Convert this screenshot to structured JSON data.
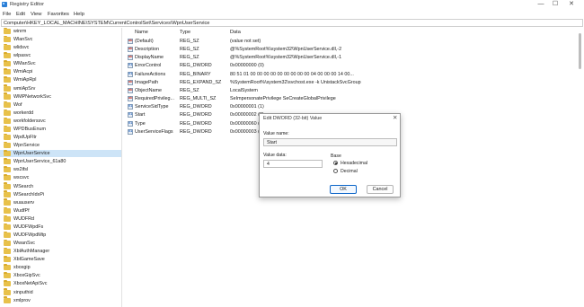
{
  "window": {
    "title": "Registry Editor",
    "min_glyph": "—",
    "max_glyph": "☐",
    "close_glyph": "✕"
  },
  "menu": [
    "File",
    "Edit",
    "View",
    "Favorites",
    "Help"
  ],
  "address": "Computer\\HKEY_LOCAL_MACHINE\\SYSTEM\\CurrentControlSet\\Services\\WpnUserService",
  "tree": {
    "items": [
      "winrm",
      "WlanSvc",
      "wlidsvc",
      "wlpasvc",
      "WManSvc",
      "WmiAcpi",
      "WmiApRpl",
      "wmiApSrv",
      "WMPNetworkSvc",
      "Wof",
      "workerdd",
      "workfolderssvc",
      "WPDBusEnum",
      "WpdUpFltr",
      "WpnService",
      "WpnUserService",
      "WpnUserService_61a80",
      "ws2ifsl",
      "wscsvc",
      "WSearch",
      "WSearchIdxPi",
      "wuauserv",
      "WudfPf",
      "WUDFRd",
      "WUDFWpdFs",
      "WUDFWpdMtp",
      "WwanSvc",
      "XblAuthManager",
      "XblGameSave",
      "xboxgip",
      "XboxGipSvc",
      "XboxNetApiSvc",
      "xinputhid",
      "xmlprov"
    ],
    "selected": "WpnUserService"
  },
  "columns": {
    "name": "Name",
    "type": "Type",
    "data": "Data"
  },
  "values": [
    {
      "icon": "string-value-icon",
      "name": "(Default)",
      "type": "REG_SZ",
      "data": "(value not set)"
    },
    {
      "icon": "string-value-icon",
      "name": "Description",
      "type": "REG_SZ",
      "data": "@%SystemRoot%\\system32\\WpnUserService.dll,-2"
    },
    {
      "icon": "string-value-icon",
      "name": "DisplayName",
      "type": "REG_SZ",
      "data": "@%SystemRoot%\\system32\\WpnUserService.dll,-1"
    },
    {
      "icon": "dword-value-icon",
      "name": "ErrorControl",
      "type": "REG_DWORD",
      "data": "0x00000000 (0)"
    },
    {
      "icon": "dword-value-icon",
      "name": "FailureActions",
      "type": "REG_BINARY",
      "data": "80 51 01 00 00 00 00 00 00 00 00 00 04 00 00 00 14 00..."
    },
    {
      "icon": "string-value-icon",
      "name": "ImagePath",
      "type": "REG_EXPAND_SZ",
      "data": "%SystemRoot%\\system32\\svchost.exe -k UnistackSvcGroup"
    },
    {
      "icon": "string-value-icon",
      "name": "ObjectName",
      "type": "REG_SZ",
      "data": "LocalSystem"
    },
    {
      "icon": "string-value-icon",
      "name": "RequiredPrivileg...",
      "type": "REG_MULTI_SZ",
      "data": "SeImpersonatePrivilege SeCreateGlobalPrivilege"
    },
    {
      "icon": "dword-value-icon",
      "name": "ServiceSidType",
      "type": "REG_DWORD",
      "data": "0x00000001 (1)"
    },
    {
      "icon": "dword-value-icon",
      "name": "Start",
      "type": "REG_DWORD",
      "data": "0x00000002 (2)"
    },
    {
      "icon": "dword-value-icon",
      "name": "Type",
      "type": "REG_DWORD",
      "data": "0x00000060 (96)"
    },
    {
      "icon": "dword-value-icon",
      "name": "UserServiceFlags",
      "type": "REG_DWORD",
      "data": "0x00000003 (3)"
    }
  ],
  "dialog": {
    "title": "Edit DWORD (32-bit) Value",
    "close_glyph": "✕",
    "value_name_label": "Value name:",
    "value_name": "Start",
    "value_data_label": "Value data:",
    "value_data": "4",
    "base_label": "Base",
    "base_options": [
      "Hexadecimal",
      "Decimal"
    ],
    "base_selected": "Hexadecimal",
    "ok_label": "OK",
    "cancel_label": "Cancel"
  },
  "colors": {
    "selection": "#cde4f7",
    "folder": "#e8c14a",
    "accent": "#0a64c8"
  }
}
